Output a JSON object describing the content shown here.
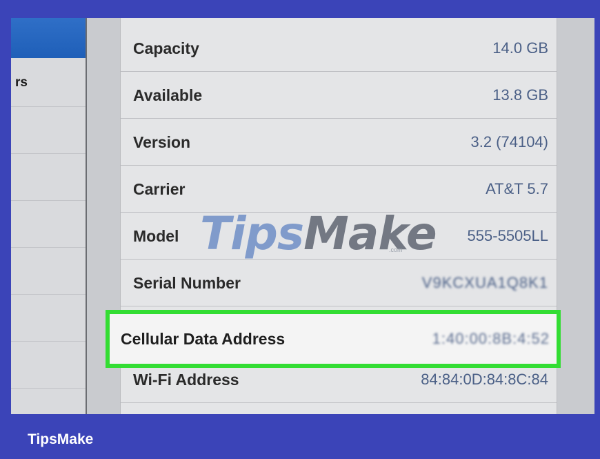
{
  "sidebar": {
    "partial_label": "rs"
  },
  "about": {
    "rows": [
      {
        "label": "Capacity",
        "value": "14.0 GB"
      },
      {
        "label": "Available",
        "value": "13.8 GB"
      },
      {
        "label": "Version",
        "value": "3.2 (74104)"
      },
      {
        "label": "Carrier",
        "value": "AT&T 5.7"
      },
      {
        "label": "Model",
        "value": "555-5505LL"
      },
      {
        "label": "Serial Number",
        "value": "V9KCXUA1Q8K1"
      },
      {
        "label": "Cellular Data Address",
        "value": "1:40:00:8B:4:52"
      },
      {
        "label": "Wi-Fi Address",
        "value": "84:84:0D:84:8C:84"
      }
    ]
  },
  "watermark": {
    "tips": "Tips",
    "make": "Make",
    "com": ".com"
  },
  "footer": {
    "brand": "TipsMake"
  },
  "colors": {
    "highlight": "#33dd33",
    "frame": "#3b44b8",
    "sidebar_selected": "#2f6fc7"
  }
}
